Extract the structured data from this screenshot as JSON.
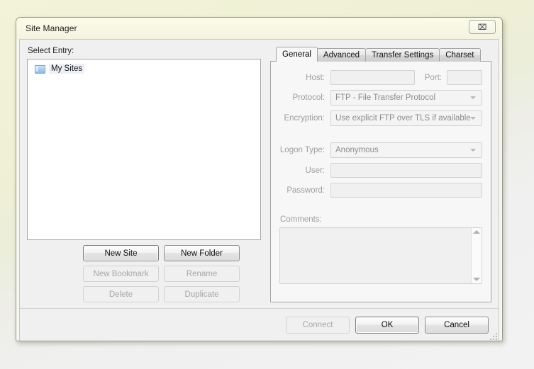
{
  "window": {
    "title": "Site Manager",
    "close_label": "⌧"
  },
  "left": {
    "select_entry_label": "Select Entry:",
    "tree": [
      {
        "label": "My Sites",
        "icon": "folder-icon",
        "selected": true
      }
    ],
    "buttons": [
      {
        "label": "New Site",
        "enabled": true
      },
      {
        "label": "New Folder",
        "enabled": true
      },
      {
        "label": "New Bookmark",
        "enabled": false
      },
      {
        "label": "Rename",
        "enabled": false
      },
      {
        "label": "Delete",
        "enabled": false
      },
      {
        "label": "Duplicate",
        "enabled": false
      }
    ]
  },
  "right": {
    "tabs": [
      {
        "label": "General",
        "active": true
      },
      {
        "label": "Advanced",
        "active": false
      },
      {
        "label": "Transfer Settings",
        "active": false
      },
      {
        "label": "Charset",
        "active": false
      }
    ],
    "general": {
      "host_label": "Host:",
      "host_value": "",
      "port_label": "Port:",
      "port_value": "",
      "protocol_label": "Protocol:",
      "protocol_value": "FTP - File Transfer Protocol",
      "encryption_label": "Encryption:",
      "encryption_value": "Use explicit FTP over TLS if available",
      "logon_type_label": "Logon Type:",
      "logon_type_value": "Anonymous",
      "user_label": "User:",
      "user_value": "",
      "password_label": "Password:",
      "password_value": "",
      "comments_label": "Comments:",
      "comments_value": ""
    }
  },
  "footer": {
    "buttons": [
      {
        "label": "Connect",
        "enabled": false,
        "default": false
      },
      {
        "label": "OK",
        "enabled": true,
        "default": true
      },
      {
        "label": "Cancel",
        "enabled": true,
        "default": false
      }
    ]
  },
  "colors": {
    "desktop_top": "#f2f3d8",
    "desktop_bottom": "#f2f2f2",
    "titlebar": "#f8f8e6",
    "dialog_border": "#9a9a86",
    "panel_bg": "#f0f0f0",
    "tab_active_bg": "#f7f7f7",
    "disabled_text": "#a6a6a6",
    "folder_icon": "#a9cbef"
  }
}
